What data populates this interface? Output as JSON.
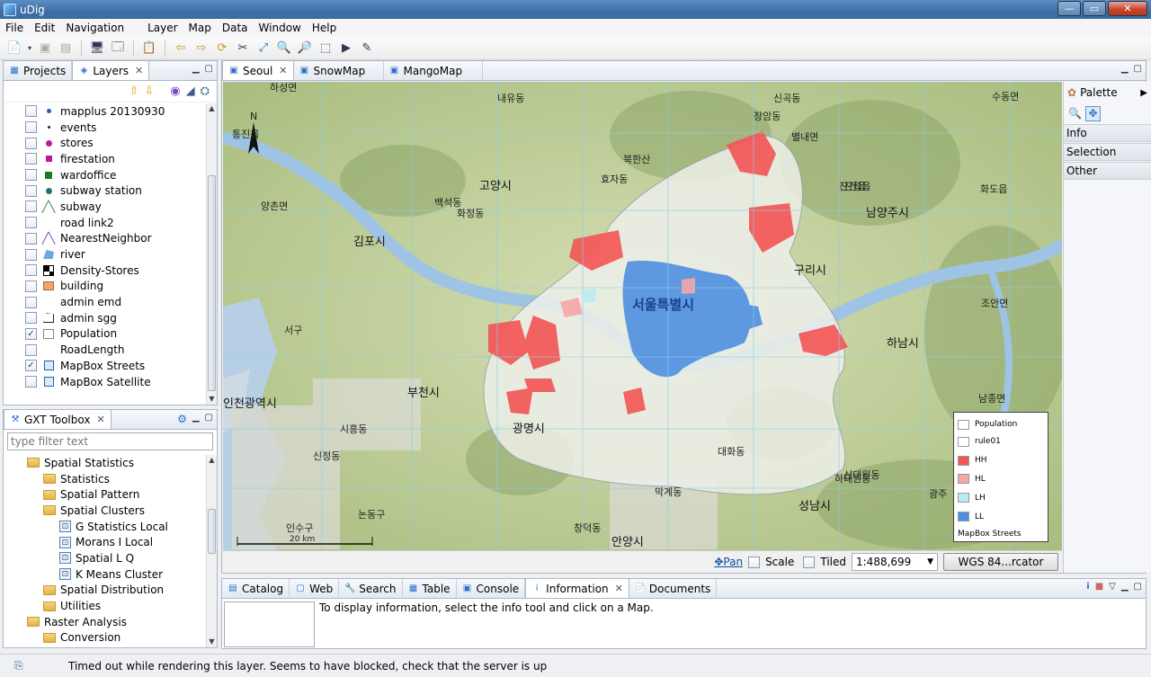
{
  "window": {
    "title": "uDig",
    "controls": {
      "minimize": "—",
      "maximize": "▭",
      "close": "✕"
    }
  },
  "menu": [
    "File",
    "Edit",
    "Navigation",
    "Layer",
    "Map",
    "Data",
    "Window",
    "Help"
  ],
  "layers_view": {
    "tabs": [
      {
        "label": "Projects"
      },
      {
        "label": "Layers"
      }
    ],
    "items": [
      {
        "label": "mapplus 20130930",
        "checked": false,
        "symbol": "dot-blue"
      },
      {
        "label": "events",
        "checked": false,
        "symbol": "dot-small"
      },
      {
        "label": "stores",
        "checked": false,
        "symbol": "dot-magenta"
      },
      {
        "label": "firestation",
        "checked": false,
        "symbol": "square-magenta"
      },
      {
        "label": "wardoffice",
        "checked": false,
        "symbol": "square-green"
      },
      {
        "label": "subway station",
        "checked": false,
        "symbol": "dot-teal"
      },
      {
        "label": "subway",
        "checked": false,
        "symbol": "line-green"
      },
      {
        "label": "road link2",
        "checked": false,
        "symbol": "none"
      },
      {
        "label": "NearestNeighbor",
        "checked": false,
        "symbol": "line-purple"
      },
      {
        "label": "river",
        "checked": false,
        "symbol": "poly-blue"
      },
      {
        "label": "Density-Stores",
        "checked": false,
        "symbol": "grid"
      },
      {
        "label": "building",
        "checked": false,
        "symbol": "poly-orange"
      },
      {
        "label": "admin emd",
        "checked": false,
        "symbol": "none"
      },
      {
        "label": "admin sgg",
        "checked": false,
        "symbol": "poly-outline"
      },
      {
        "label": "Population",
        "checked": true,
        "symbol": "poly-outline-light"
      },
      {
        "label": "RoadLength",
        "checked": false,
        "symbol": "none"
      },
      {
        "label": "MapBox Streets",
        "checked": true,
        "symbol": "raster"
      },
      {
        "label": "MapBox Satellite",
        "checked": false,
        "symbol": "raster"
      }
    ]
  },
  "toolbox": {
    "title": "GXT Toolbox",
    "filter_placeholder": "type filter text",
    "tree": [
      {
        "label": "Spatial Statistics",
        "kind": "folder",
        "level": 1
      },
      {
        "label": "Statistics",
        "kind": "folder",
        "level": 2
      },
      {
        "label": "Spatial Pattern",
        "kind": "folder",
        "level": 2
      },
      {
        "label": "Spatial Clusters",
        "kind": "folder",
        "level": 2
      },
      {
        "label": "G Statistics Local",
        "kind": "tool",
        "level": 3
      },
      {
        "label": "Morans I Local",
        "kind": "tool",
        "level": 3
      },
      {
        "label": "Spatial L Q",
        "kind": "tool",
        "level": 3
      },
      {
        "label": "K Means Cluster",
        "kind": "tool",
        "level": 3
      },
      {
        "label": "Spatial Distribution",
        "kind": "folder",
        "level": 2
      },
      {
        "label": "Utilities",
        "kind": "folder",
        "level": 2
      },
      {
        "label": "Raster Analysis",
        "kind": "folder",
        "level": 1
      },
      {
        "label": "Conversion",
        "kind": "folder",
        "level": 2
      }
    ]
  },
  "editor_tabs": [
    {
      "label": "Seoul"
    },
    {
      "label": "SnowMap"
    },
    {
      "label": "MangoMap"
    }
  ],
  "map": {
    "north_label": "N",
    "scalebar_label": "20 km",
    "place_labels": [
      "하성면",
      "통진읍",
      "양촌면",
      "김포시",
      "서구",
      "인천광역시",
      "부천시",
      "시흥동",
      "고양시",
      "백석동",
      "화정동",
      "내유동",
      "효자동",
      "북한산",
      "신곡동",
      "장암동",
      "별내면",
      "진접읍",
      "진건읍",
      "남양주시",
      "구리시",
      "화도읍",
      "수동면",
      "조안면",
      "하남시",
      "남종면",
      "서울특별시",
      "광명시",
      "안양시",
      "성남시",
      "막계동",
      "신대원동",
      "광주",
      "하대원동",
      "인수구",
      "논동구",
      "대화동",
      "신정동",
      "창덕동"
    ],
    "legend": {
      "title": "Population",
      "entries": [
        {
          "label": "rule01",
          "color": "#ffffff"
        },
        {
          "label": "HH",
          "color": "#f25757"
        },
        {
          "label": "HL",
          "color": "#f7a6a6"
        },
        {
          "label": "LH",
          "color": "#b9ecf2"
        },
        {
          "label": "LL",
          "color": "#4f8fe0"
        }
      ],
      "basemap": "MapBox Streets"
    }
  },
  "map_status": {
    "pan": "Pan",
    "scale": "Scale",
    "tiled": "Tiled",
    "scale_value": "1:488,699",
    "crs": "WGS 84...rcator"
  },
  "palette": {
    "title": "Palette",
    "drawers": [
      "Info",
      "Selection",
      "Other"
    ]
  },
  "bottom_tabs": [
    {
      "label": "Catalog"
    },
    {
      "label": "Web"
    },
    {
      "label": "Search"
    },
    {
      "label": "Table"
    },
    {
      "label": "Console"
    },
    {
      "label": "Information"
    },
    {
      "label": "Documents"
    }
  ],
  "information_text": "To display information, select the info tool and click on a Map.",
  "status_message": "Timed out while rendering this layer.  Seems to have blocked, check that the server is up"
}
